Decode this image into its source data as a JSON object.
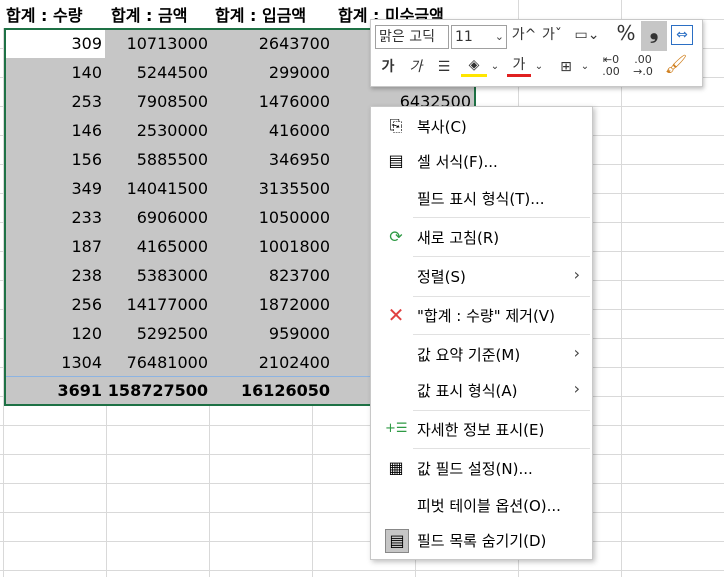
{
  "headers": [
    "합계 : 수량",
    "합계 : 금액",
    "합계 : 입금액",
    "합계 : 미수금액"
  ],
  "rows": [
    [
      "309",
      "10713000",
      "2643700",
      ""
    ],
    [
      "140",
      "5244500",
      "299000",
      ""
    ],
    [
      "253",
      "7908500",
      "1476000",
      "6432500"
    ],
    [
      "146",
      "2530000",
      "416000",
      ""
    ],
    [
      "156",
      "5885500",
      "346950",
      ""
    ],
    [
      "349",
      "14041500",
      "3135500",
      ""
    ],
    [
      "233",
      "6906000",
      "1050000",
      ""
    ],
    [
      "187",
      "4165000",
      "1001800",
      ""
    ],
    [
      "238",
      "5383000",
      "823700",
      ""
    ],
    [
      "256",
      "14177000",
      "1872000",
      ""
    ],
    [
      "120",
      "5292500",
      "959000",
      ""
    ],
    [
      "1304",
      "76481000",
      "2102400",
      ""
    ]
  ],
  "totals": [
    "3691",
    "158727500",
    "16126050"
  ],
  "toolbar": {
    "font_name": "맑은 고딕",
    "font_size": "11",
    "grow_font": "가^",
    "shrink_font": "가ˇ",
    "bold": "가",
    "italic": "가",
    "percent": "%",
    "comma": "❟",
    "font_color_label": "가"
  },
  "menu": {
    "copy": "복사(C)",
    "format_cells": "셀 서식(F)...",
    "number_format": "필드 표시 형식(T)...",
    "refresh": "새로 고침(R)",
    "sort": "정렬(S)",
    "remove": "\"합계 : 수량\" 제거(V)",
    "summarize": "값 요약 기준(M)",
    "show_as": "값 표시 형식(A)",
    "show_details": "자세한 정보 표시(E)",
    "field_settings": "값 필드 설정(N)...",
    "pivot_options": "피벗 테이블 옵션(O)...",
    "hide_field_list": "필드 목록 숨기기(D)"
  },
  "colors": {
    "selection_border": "#1e7145",
    "selection_fill": "#c6c6c6",
    "remove_icon": "#e04040"
  }
}
